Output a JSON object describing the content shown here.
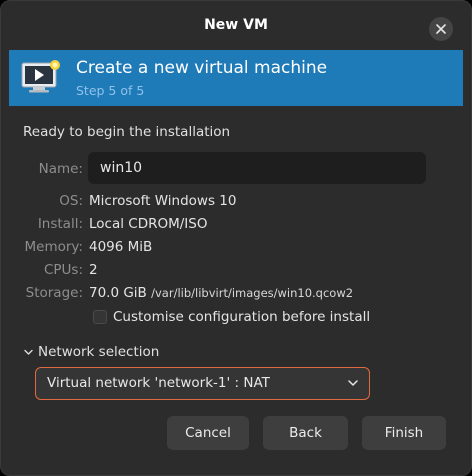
{
  "window": {
    "title": "New VM",
    "close_icon": "close-icon"
  },
  "banner": {
    "icon": "virtual-machine-monitor-icon",
    "title": "Create a new virtual machine",
    "subtitle": "Step 5 of 5",
    "color": "#1f7ab8"
  },
  "summary": {
    "heading": "Ready to begin the installation",
    "name_label": "Name:",
    "name_value": "win10",
    "os_label": "OS:",
    "os_value": "Microsoft Windows 10",
    "install_label": "Install:",
    "install_value": "Local CDROM/ISO",
    "memory_label": "Memory:",
    "memory_value": "4096 MiB",
    "cpus_label": "CPUs:",
    "cpus_value": "2",
    "storage_label": "Storage:",
    "storage_size": "70.0 GiB",
    "storage_path": "/var/lib/libvirt/images/win10.qcow2"
  },
  "customise": {
    "label": "Customise configuration before install",
    "checked": false
  },
  "network": {
    "expander_label": "Network selection",
    "expanded": true,
    "selected": "Virtual network 'network-1' : NAT",
    "accent": "#e06a3f"
  },
  "buttons": {
    "cancel": "Cancel",
    "back": "Back",
    "finish": "Finish"
  }
}
